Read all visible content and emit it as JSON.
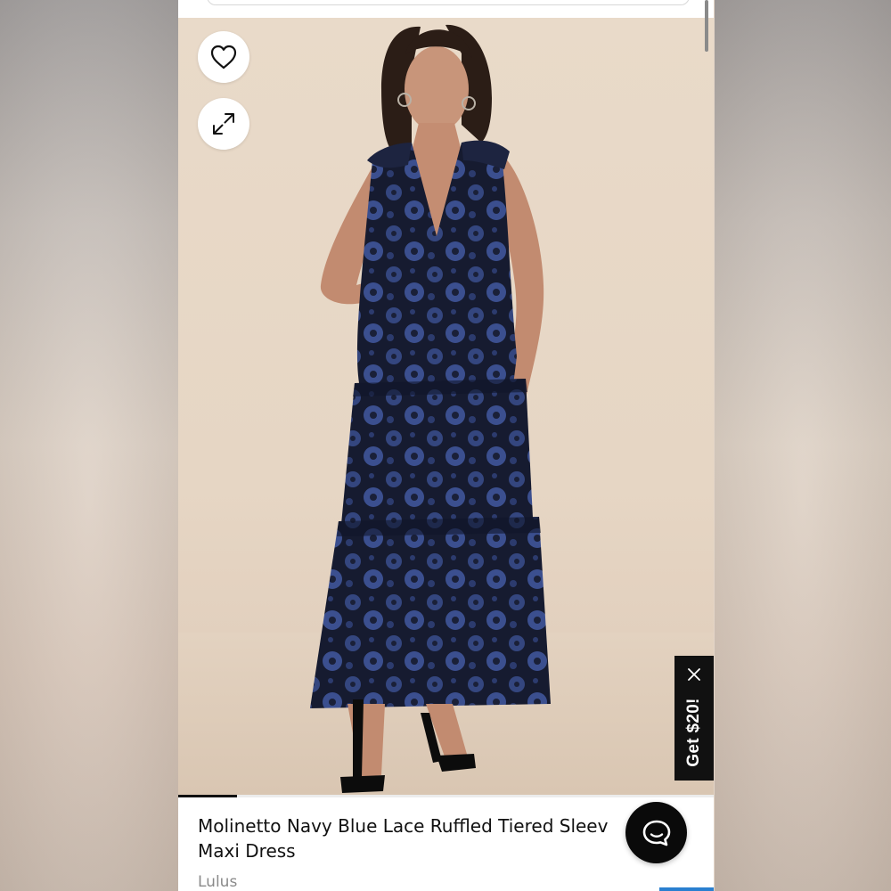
{
  "product": {
    "title_line1": "Molinetto Navy Blue Lace Ruffled Tiered Sleev",
    "title_line2": "Maxi Dress",
    "brand": "Lulus"
  },
  "promo": {
    "label": "Get $20!"
  },
  "gallery": {
    "progress_fraction": 0.11
  },
  "icons": {
    "favorite": "heart-icon",
    "expand": "expand-icon",
    "close": "close-icon",
    "chat": "chat-bubble-icon"
  },
  "colors": {
    "dress_navy": "#1c2340",
    "lace_blue": "#3b4f8f",
    "accent_black": "#0a0a0a",
    "link_blue": "#2a7fd0"
  }
}
